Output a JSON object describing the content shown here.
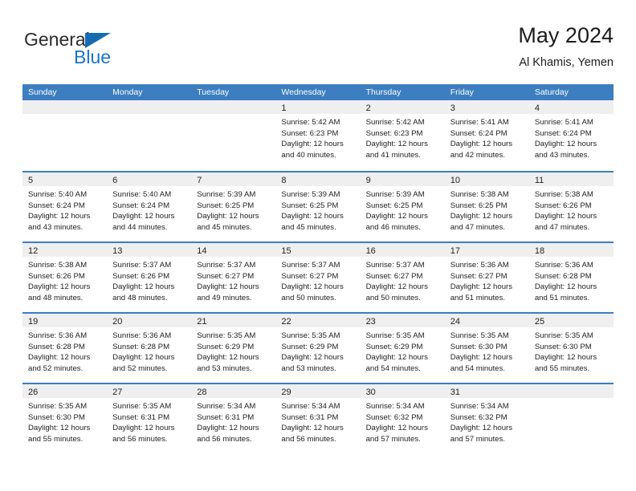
{
  "brand": {
    "name_part1": "General",
    "name_part2": "Blue",
    "triangle_color": "#156cb0",
    "blue_color": "#1876c8"
  },
  "header": {
    "title": "May 2024",
    "subtitle": "Al Khamis, Yemen"
  },
  "theme": {
    "header_blue": "#3c7ebf",
    "day_band_gray": "#efefef",
    "text_color": "#222222"
  },
  "weekdays": [
    "Sunday",
    "Monday",
    "Tuesday",
    "Wednesday",
    "Thursday",
    "Friday",
    "Saturday"
  ],
  "weeks": [
    [
      {
        "day": "",
        "lines": [
          "",
          "",
          "",
          ""
        ]
      },
      {
        "day": "",
        "lines": [
          "",
          "",
          "",
          ""
        ]
      },
      {
        "day": "",
        "lines": [
          "",
          "",
          "",
          ""
        ]
      },
      {
        "day": "1",
        "lines": [
          "Sunrise: 5:42 AM",
          "Sunset: 6:23 PM",
          "Daylight: 12 hours",
          "and 40 minutes."
        ]
      },
      {
        "day": "2",
        "lines": [
          "Sunrise: 5:42 AM",
          "Sunset: 6:23 PM",
          "Daylight: 12 hours",
          "and 41 minutes."
        ]
      },
      {
        "day": "3",
        "lines": [
          "Sunrise: 5:41 AM",
          "Sunset: 6:24 PM",
          "Daylight: 12 hours",
          "and 42 minutes."
        ]
      },
      {
        "day": "4",
        "lines": [
          "Sunrise: 5:41 AM",
          "Sunset: 6:24 PM",
          "Daylight: 12 hours",
          "and 43 minutes."
        ]
      }
    ],
    [
      {
        "day": "5",
        "lines": [
          "Sunrise: 5:40 AM",
          "Sunset: 6:24 PM",
          "Daylight: 12 hours",
          "and 43 minutes."
        ]
      },
      {
        "day": "6",
        "lines": [
          "Sunrise: 5:40 AM",
          "Sunset: 6:24 PM",
          "Daylight: 12 hours",
          "and 44 minutes."
        ]
      },
      {
        "day": "7",
        "lines": [
          "Sunrise: 5:39 AM",
          "Sunset: 6:25 PM",
          "Daylight: 12 hours",
          "and 45 minutes."
        ]
      },
      {
        "day": "8",
        "lines": [
          "Sunrise: 5:39 AM",
          "Sunset: 6:25 PM",
          "Daylight: 12 hours",
          "and 45 minutes."
        ]
      },
      {
        "day": "9",
        "lines": [
          "Sunrise: 5:39 AM",
          "Sunset: 6:25 PM",
          "Daylight: 12 hours",
          "and 46 minutes."
        ]
      },
      {
        "day": "10",
        "lines": [
          "Sunrise: 5:38 AM",
          "Sunset: 6:25 PM",
          "Daylight: 12 hours",
          "and 47 minutes."
        ]
      },
      {
        "day": "11",
        "lines": [
          "Sunrise: 5:38 AM",
          "Sunset: 6:26 PM",
          "Daylight: 12 hours",
          "and 47 minutes."
        ]
      }
    ],
    [
      {
        "day": "12",
        "lines": [
          "Sunrise: 5:38 AM",
          "Sunset: 6:26 PM",
          "Daylight: 12 hours",
          "and 48 minutes."
        ]
      },
      {
        "day": "13",
        "lines": [
          "Sunrise: 5:37 AM",
          "Sunset: 6:26 PM",
          "Daylight: 12 hours",
          "and 48 minutes."
        ]
      },
      {
        "day": "14",
        "lines": [
          "Sunrise: 5:37 AM",
          "Sunset: 6:27 PM",
          "Daylight: 12 hours",
          "and 49 minutes."
        ]
      },
      {
        "day": "15",
        "lines": [
          "Sunrise: 5:37 AM",
          "Sunset: 6:27 PM",
          "Daylight: 12 hours",
          "and 50 minutes."
        ]
      },
      {
        "day": "16",
        "lines": [
          "Sunrise: 5:37 AM",
          "Sunset: 6:27 PM",
          "Daylight: 12 hours",
          "and 50 minutes."
        ]
      },
      {
        "day": "17",
        "lines": [
          "Sunrise: 5:36 AM",
          "Sunset: 6:27 PM",
          "Daylight: 12 hours",
          "and 51 minutes."
        ]
      },
      {
        "day": "18",
        "lines": [
          "Sunrise: 5:36 AM",
          "Sunset: 6:28 PM",
          "Daylight: 12 hours",
          "and 51 minutes."
        ]
      }
    ],
    [
      {
        "day": "19",
        "lines": [
          "Sunrise: 5:36 AM",
          "Sunset: 6:28 PM",
          "Daylight: 12 hours",
          "and 52 minutes."
        ]
      },
      {
        "day": "20",
        "lines": [
          "Sunrise: 5:36 AM",
          "Sunset: 6:28 PM",
          "Daylight: 12 hours",
          "and 52 minutes."
        ]
      },
      {
        "day": "21",
        "lines": [
          "Sunrise: 5:35 AM",
          "Sunset: 6:29 PM",
          "Daylight: 12 hours",
          "and 53 minutes."
        ]
      },
      {
        "day": "22",
        "lines": [
          "Sunrise: 5:35 AM",
          "Sunset: 6:29 PM",
          "Daylight: 12 hours",
          "and 53 minutes."
        ]
      },
      {
        "day": "23",
        "lines": [
          "Sunrise: 5:35 AM",
          "Sunset: 6:29 PM",
          "Daylight: 12 hours",
          "and 54 minutes."
        ]
      },
      {
        "day": "24",
        "lines": [
          "Sunrise: 5:35 AM",
          "Sunset: 6:30 PM",
          "Daylight: 12 hours",
          "and 54 minutes."
        ]
      },
      {
        "day": "25",
        "lines": [
          "Sunrise: 5:35 AM",
          "Sunset: 6:30 PM",
          "Daylight: 12 hours",
          "and 55 minutes."
        ]
      }
    ],
    [
      {
        "day": "26",
        "lines": [
          "Sunrise: 5:35 AM",
          "Sunset: 6:30 PM",
          "Daylight: 12 hours",
          "and 55 minutes."
        ]
      },
      {
        "day": "27",
        "lines": [
          "Sunrise: 5:35 AM",
          "Sunset: 6:31 PM",
          "Daylight: 12 hours",
          "and 56 minutes."
        ]
      },
      {
        "day": "28",
        "lines": [
          "Sunrise: 5:34 AM",
          "Sunset: 6:31 PM",
          "Daylight: 12 hours",
          "and 56 minutes."
        ]
      },
      {
        "day": "29",
        "lines": [
          "Sunrise: 5:34 AM",
          "Sunset: 6:31 PM",
          "Daylight: 12 hours",
          "and 56 minutes."
        ]
      },
      {
        "day": "30",
        "lines": [
          "Sunrise: 5:34 AM",
          "Sunset: 6:32 PM",
          "Daylight: 12 hours",
          "and 57 minutes."
        ]
      },
      {
        "day": "31",
        "lines": [
          "Sunrise: 5:34 AM",
          "Sunset: 6:32 PM",
          "Daylight: 12 hours",
          "and 57 minutes."
        ]
      },
      {
        "day": "",
        "lines": [
          "",
          "",
          "",
          ""
        ]
      }
    ]
  ]
}
